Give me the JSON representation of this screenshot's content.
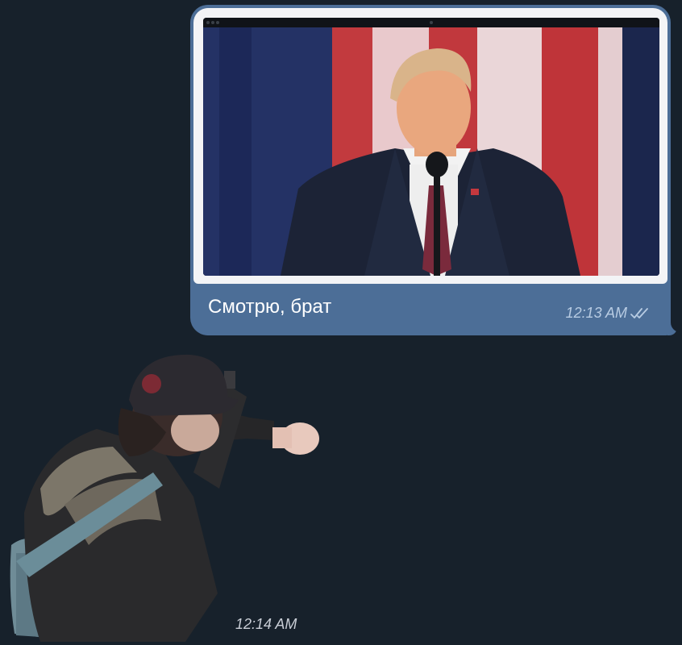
{
  "chat": {
    "background": "#17212b",
    "bubble_color": "#4c6e97"
  },
  "outgoing_message": {
    "media": {
      "type": "photo",
      "description_icon": "video-screenshot-speaker-at-podium",
      "back_glyph": "←"
    },
    "text": "Смотрю, брат",
    "time": "12:13 AM",
    "status_icon": "double-check-read-icon"
  },
  "incoming_sticker": {
    "icon": "person-with-camera-sticker",
    "time": "12:14 AM"
  }
}
